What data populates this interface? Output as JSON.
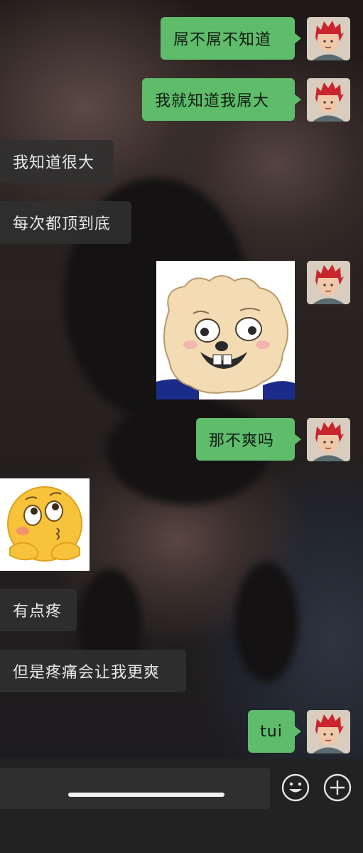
{
  "messages": [
    {
      "side": "sent",
      "type": "text",
      "text": "屌不屌不知道"
    },
    {
      "side": "sent",
      "type": "text",
      "text": "我就知道我屌大"
    },
    {
      "side": "received",
      "type": "text",
      "text": "我知道很大"
    },
    {
      "side": "received",
      "type": "text",
      "text": "每次都顶到底"
    },
    {
      "side": "sent",
      "type": "sticker",
      "sticker": "cartoon-sheep-face"
    },
    {
      "side": "sent",
      "type": "text",
      "text": "那不爽吗"
    },
    {
      "side": "received",
      "type": "sticker",
      "sticker": "shy-thinking-emoji"
    },
    {
      "side": "received",
      "type": "text",
      "text": "有点疼"
    },
    {
      "side": "received",
      "type": "text",
      "text": "但是疼痛会让我更爽"
    },
    {
      "side": "sent",
      "type": "text",
      "text": "tui"
    }
  ],
  "input_bar": {
    "text_field_value": "",
    "emoji_button_icon": "smiley-face-icon",
    "more_button_icon": "plus-circle-icon"
  },
  "colors": {
    "sent_bubble": "#5ebc6b",
    "received_bubble": "#303030",
    "input_bar": "#222222"
  }
}
